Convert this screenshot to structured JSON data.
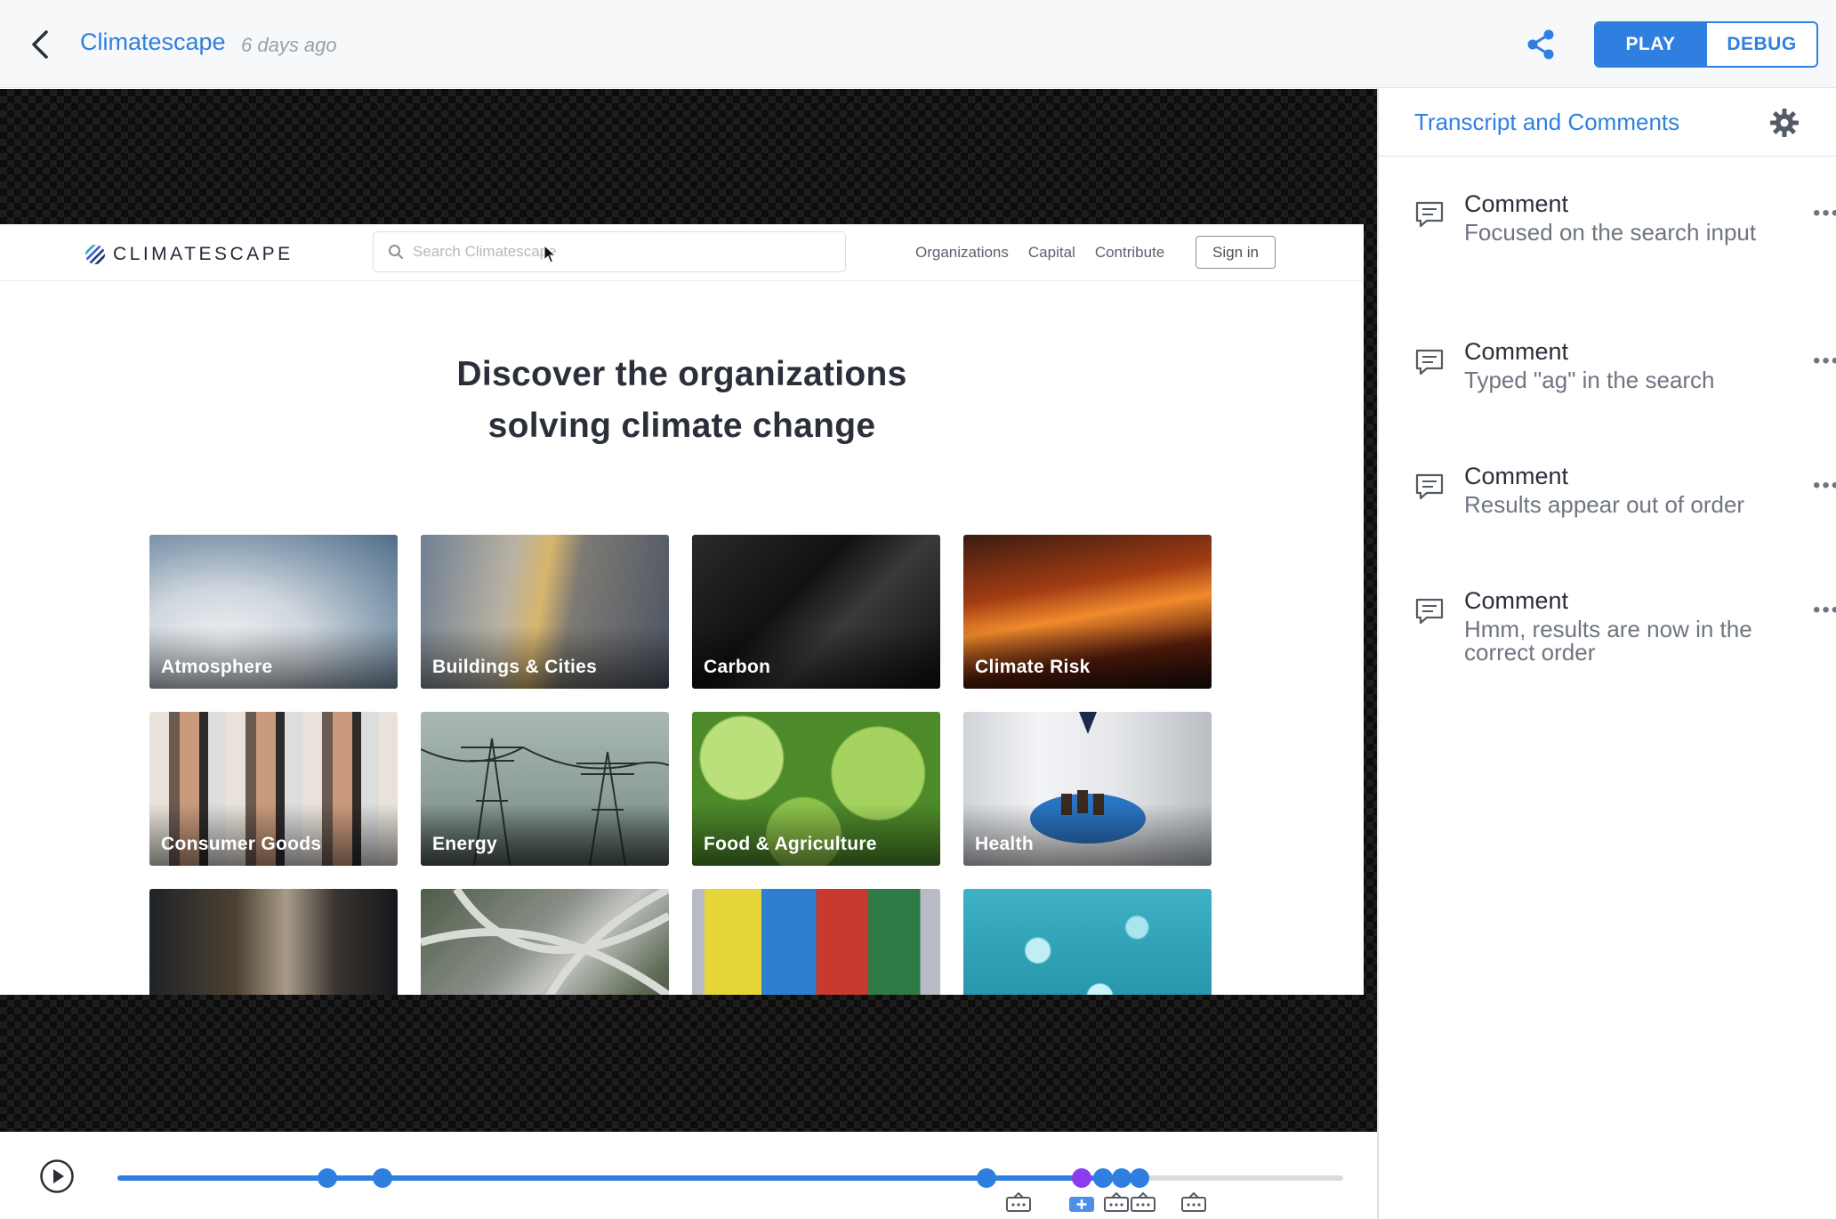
{
  "header": {
    "title": "Climatescape",
    "meta": "6 days ago",
    "modes": [
      "PLAY",
      "DEBUG"
    ],
    "active_mode": "PLAY"
  },
  "site": {
    "logo_text": "CLIMATESCAPE",
    "search_placeholder": "Search Climatescape",
    "nav_links": [
      "Organizations",
      "Capital",
      "Contribute"
    ],
    "signin_label": "Sign in",
    "hero_line1": "Discover the organizations",
    "hero_line2": "solving climate change",
    "tiles": [
      "Atmosphere",
      "Buildings & Cities",
      "Carbon",
      "Climate Risk",
      "Consumer Goods",
      "Energy",
      "Food & Agriculture",
      "Health",
      "",
      "",
      "",
      ""
    ]
  },
  "panel": {
    "title": "Transcript and Comments",
    "comments": [
      {
        "title": "Comment",
        "body": "Focused on the search input"
      },
      {
        "title": "Comment",
        "body": "Typed \"ag\" in the search"
      },
      {
        "title": "Comment",
        "body": "Results appear out of order"
      },
      {
        "title": "Comment",
        "body": "Hmm, results are now in the correct order"
      }
    ]
  },
  "timeline": {
    "progress": 0.835,
    "markers": [
      0.171,
      0.216,
      0.709,
      0.787,
      0.804,
      0.819,
      0.834
    ],
    "marker_colors": [
      "#2f7fe0",
      "#2f7fe0",
      "#2f7fe0",
      "#8a3cf0",
      "#2f7fe0",
      "#2f7fe0",
      "#2f7fe0"
    ],
    "events": [
      0.735,
      0.787,
      0.815,
      0.837,
      0.878
    ]
  },
  "colors": {
    "accent": "#2f7fe0",
    "purple_marker": "#8a3cf0"
  }
}
